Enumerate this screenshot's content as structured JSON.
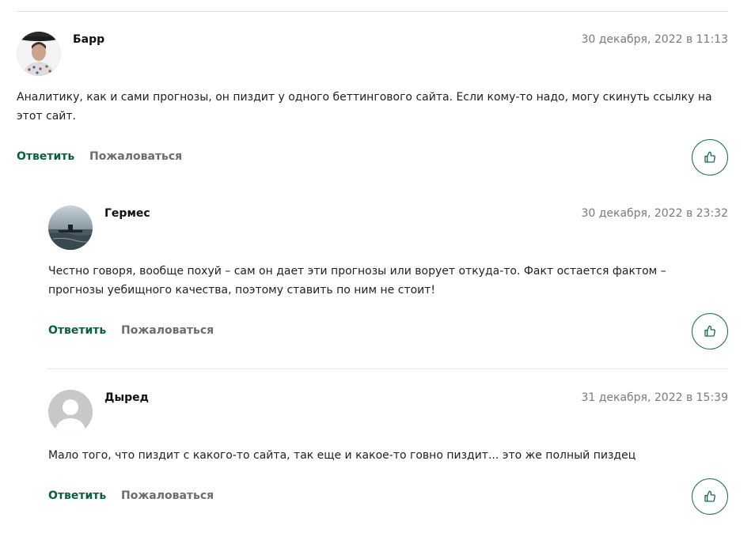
{
  "comments": [
    {
      "author": "Барр",
      "date": "30 декабря, 2022 в 11:13",
      "text": "Аналитику, как и сами прогнозы, он пиздит у одного беттингового сайта. Если кому-то надо, могу скинуть ссылку на этот сайт.",
      "reply_label": "Ответить",
      "report_label": "Пожаловаться",
      "avatar": "user-photo"
    },
    {
      "author": "Гермес",
      "date": "30 декабря, 2022 в 23:32",
      "text": "Честно говоря, вообще похуй – сам он дает эти прогнозы или ворует откуда-то. Факт остается фактом – прогнозы уебищного качества, поэтому ставить по ним не стоит!",
      "reply_label": "Ответить",
      "report_label": "Пожаловаться",
      "avatar": "submarine-photo"
    },
    {
      "author": "Дыред",
      "date": "31 декабря, 2022 в 15:39",
      "text": "Мало того, что пиздит с какого-то сайта, так еще и какое-то говно пиздит... это же полный пиздец",
      "reply_label": "Ответить",
      "report_label": "Пожаловаться",
      "avatar": "default-avatar"
    }
  ],
  "colors": {
    "accent": "#0c5e40",
    "like_border": "#1b6b4e",
    "date": "#7a7a7a",
    "report": "#6c6c6c",
    "divider": "#e4e7ea"
  },
  "icons": {
    "like": "thumbs-up-icon"
  }
}
